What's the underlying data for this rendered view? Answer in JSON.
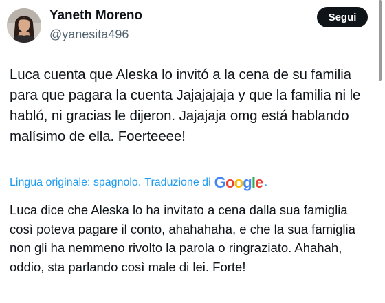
{
  "author": {
    "display_name": "Yaneth Moreno",
    "handle": "@yanesita496"
  },
  "follow_button": {
    "label": "Segui"
  },
  "tweet": {
    "original_text": "Luca cuenta que Aleska lo invitó a la cena de su familia para que pagara la cuenta Jajajajaja y que la familia ni le habló, ni gracias le dijeron. Jajajaja omg está hablando malísimo de ella. Foerteeee!",
    "translation": {
      "original_language_label": "Lingua originale: spagnolo.",
      "translated_by_label": "Traduzione di",
      "provider_logo": "Google",
      "trailing_dot": ".",
      "translated_text": "Luca dice che Aleska lo ha invitato a cena dalla sua famiglia così poteva pagare il conto, ahahahaha, e che la sua famiglia non gli ha nemmeno rivolto la parola o ringraziato. Ahahah, oddio, sta parlando così male di lei. Forte!"
    }
  },
  "colors": {
    "text_primary": "#0f1419",
    "text_secondary": "#536471",
    "link_blue": "#1d9bf0",
    "button_bg": "#0f1419",
    "button_text": "#ffffff"
  },
  "icons": {
    "avatar": "profile-photo"
  }
}
